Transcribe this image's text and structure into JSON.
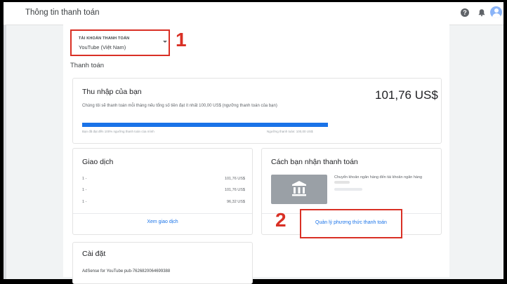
{
  "header": {
    "title": "Thông tin thanh toán",
    "icons": {
      "help": "help-circle-icon",
      "notifications": "bell-icon",
      "account": "avatar-icon"
    }
  },
  "account_selector": {
    "label": "TÀI KHOẢN THANH TOÁN",
    "value": "YouTube (Việt Nam)"
  },
  "annotations": {
    "step1": "1",
    "step2": "2",
    "color": "#d93025"
  },
  "section_title": "Thanh toán",
  "earnings": {
    "title": "Thu nhập của bạn",
    "amount": "101,76 US$",
    "description": "Chúng tôi sẽ thanh toán mỗi tháng nếu tổng số tiền đạt ít nhất 100,00 US$ (ngưỡng thanh toán của bạn)",
    "progress_fraction": 1.0,
    "progress_caption_left": "Bạn đã đạt đến 100% ngưỡng thanh toán của mình",
    "progress_caption_right": "Ngưỡng thanh toán: 100,00 US$",
    "accent": "#1a73e8"
  },
  "transactions": {
    "title": "Giao dịch",
    "rows": [
      {
        "date": "1 -",
        "value": "101,76 US$"
      },
      {
        "date": "1 -",
        "value": "101,76 US$"
      },
      {
        "date": "1 -",
        "value": "96,32 US$"
      }
    ],
    "link": "Xem giao dịch"
  },
  "payment": {
    "title": "Cách bạn nhận thanh toán",
    "method": "Chuyển khoản ngân hàng đến tài khoản ngân hàng",
    "bank_icon": "bank-icon",
    "manage_link": "Quản lý phương thức thanh toán"
  },
  "settings": {
    "title": "Cài đặt",
    "account": "AdSense for YouTube pub-7626820064699388"
  }
}
